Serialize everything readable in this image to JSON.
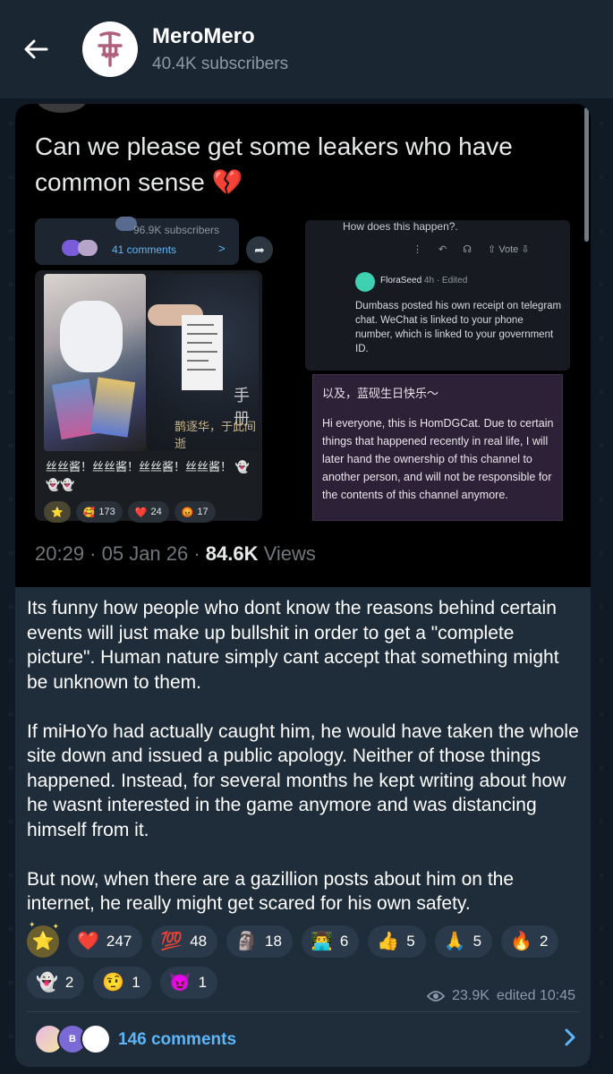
{
  "header": {
    "back_icon": "arrow-left-icon",
    "channel_name": "MeroMero",
    "subscribers": "40.4K subscribers",
    "avatar_icon": "channel-logo-icon"
  },
  "post": {
    "media": {
      "title": "Can we please get some leakers who have common sense",
      "title_emoji": "💔",
      "left_panel": {
        "subscribers": "96.9K subscribers",
        "comments": "41 comments",
        "chant": "丝丝酱！丝丝酱！丝丝酱！丝丝酱！",
        "chant_emoji": "👻👻👻",
        "book_text": "鹊逐华，于此间逝",
        "book_side": "手册",
        "reactions": [
          {
            "emoji": "⭐",
            "count": ""
          },
          {
            "emoji": "🥰",
            "count": "173"
          },
          {
            "emoji": "❤️",
            "count": "24"
          },
          {
            "emoji": "😡",
            "count": "17"
          }
        ]
      },
      "right_top": {
        "question": "How does this happen?.",
        "tools": [
          "⋮",
          "↶",
          "☊",
          "⇧ Vote ⇩"
        ],
        "user": "FloraSeed",
        "user_meta": "4h · Edited",
        "body": "Dumbass posted his own receipt on telegram chat. WeChat is linked to your phone number, which is linked to your government ID."
      },
      "right_bottom": {
        "cn": "以及，蓝砚生日快乐～",
        "en": "Hi everyone, this is HomDGCat. Due to certain things that happened recently in real life, I will later hand the ownership of this channel to another person, and will not be responsible for the contents of this channel anymore."
      },
      "footer": {
        "time": "20:29 · 05 Jan 26 · ",
        "views_count": "84.6K",
        "views_label": " Views"
      }
    },
    "caption": [
      "Its funny how people who dont know the reasons behind certain events will just make up bullshit in order to get a \"complete picture\". Human nature simply cant accept that something might be unknown to them.",
      "If miHoYo had actually caught him, he would have taken the whole site down and issued a public apology. Neither of those things happened. Instead, for several months he kept writing about how he wasnt interested in the game anymore and was distancing himself from it.",
      "But now, when there are a gazillion posts about him on the internet, he really might get scared for his own safety."
    ],
    "reactions": [
      {
        "emoji": "⭐",
        "count": "",
        "paid": true
      },
      {
        "emoji": "❤️",
        "count": "247"
      },
      {
        "emoji": "💯",
        "count": "48"
      },
      {
        "emoji": "🗿",
        "count": "18"
      },
      {
        "emoji": "👨‍💻",
        "count": "6"
      },
      {
        "emoji": "👍",
        "count": "5"
      },
      {
        "emoji": "🙏",
        "count": "5"
      },
      {
        "emoji": "🔥",
        "count": "2"
      },
      {
        "emoji": "👻",
        "count": "2"
      },
      {
        "emoji": "🤨",
        "count": "1"
      },
      {
        "emoji": "😈",
        "count": "1"
      }
    ],
    "views": "23.9K",
    "edited": "edited 10:45",
    "comments_label": "146 comments",
    "comment_avatar_letter": "B"
  },
  "colors": {
    "accent": "#5eb5f7",
    "card_bg": "#1f2c3a",
    "header_bg": "#1a2733",
    "page_bg": "#0f1a24"
  }
}
